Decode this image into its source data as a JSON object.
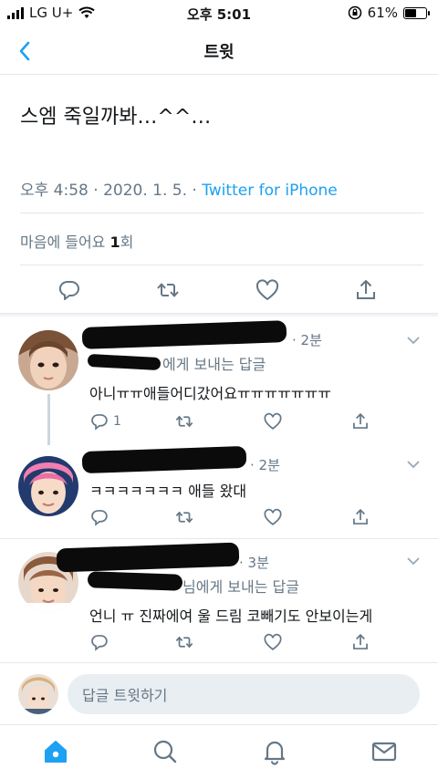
{
  "status_bar": {
    "carrier": "LG U+",
    "time": "오후 5:01",
    "battery": "61%",
    "battery_level": 0.61
  },
  "nav": {
    "title": "트윗"
  },
  "tweet": {
    "text": "스엠 죽일까봐…^^…",
    "time": "오후 4:58 · 2020. 1. 5. · ",
    "source": "Twitter for iPhone",
    "likes_label": "마음에 들어요 ",
    "likes_count": "1",
    "likes_suffix": "회"
  },
  "replies": [
    {
      "time": "· 2분",
      "reply_to": "에게 보내는 답글",
      "text": "아니ㅠㅠ애들어디갔어요ㅠㅠㅠㅠㅠㅠㅠ",
      "reply_count": "1"
    },
    {
      "time": "· 2분",
      "text": "ㅋㅋㅋㅋㅋㅋㅋ 애들 왔대",
      "reply_count": ""
    },
    {
      "time": "· 3분",
      "reply_to": "님에게 보내는 답글",
      "text": "언니 ㅠ 진짜에여 울 드림 코빼기도 안보이는게",
      "reply_count": ""
    }
  ],
  "composer": {
    "placeholder": "답글 트윗하기"
  },
  "colors": {
    "accent": "#1da1f2",
    "secondary_text": "#657786",
    "divider": "#e1e8ed"
  },
  "icons": [
    "back-chevron-icon",
    "reply-icon",
    "retweet-icon",
    "like-icon",
    "share-icon",
    "home-icon",
    "search-icon",
    "notifications-icon",
    "messages-icon"
  ]
}
